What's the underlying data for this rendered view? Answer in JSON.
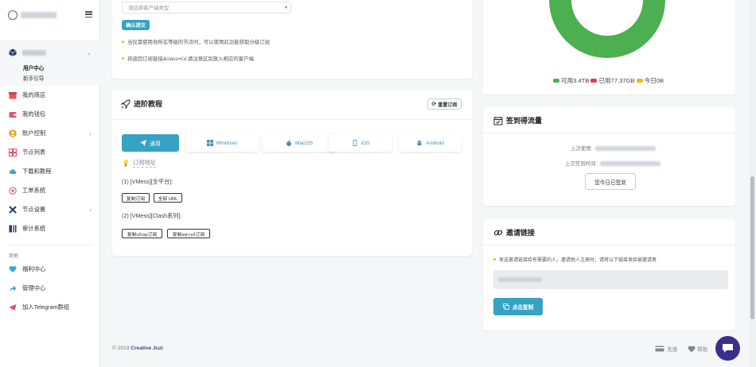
{
  "sidebar": {
    "nav": {
      "user_submenu": [
        "用户中心",
        "新手引导"
      ],
      "items": [
        {
          "label": "我的商店",
          "icon": "store-icon",
          "color": "#e85555"
        },
        {
          "label": "我的钱包",
          "icon": "wallet-icon",
          "color": "#e05470"
        },
        {
          "label": "账户控制",
          "icon": "account-icon",
          "color": "#f0a020",
          "chevron": "›"
        },
        {
          "label": "节点列表",
          "icon": "node-list-icon",
          "color": "#e05470"
        },
        {
          "label": "下载和教程",
          "icon": "cloud-download-icon",
          "color": "#3aa7d6"
        },
        {
          "label": "工单系统",
          "icon": "ticket-icon",
          "color": "#e56a6a"
        },
        {
          "label": "节点设置",
          "icon": "tools-icon",
          "color": "#2b3a67",
          "chevron": "›"
        },
        {
          "label": "审计系统",
          "icon": "audit-icon",
          "color": "#2b3a67"
        }
      ],
      "other_heading": "其他",
      "other_items": [
        {
          "label": "福利中心",
          "icon": "heart-icon",
          "color": "#3aa7d6"
        },
        {
          "label": "管理中心",
          "icon": "share-icon",
          "color": "#3aa7d6"
        },
        {
          "label": "加入Telegram群组",
          "icon": "telegram-icon",
          "color": "#e04e6e"
        }
      ]
    }
  },
  "subscribe_card": {
    "select_placeholder": "请选择客户端类型",
    "confirm_button": "确认提交",
    "notes": [
      "当仅需使用你所在等级的节点时，可以使用此功能获取分级订阅",
      "将返回订阅链接&class=LV,请注意区别放入相应的客户端"
    ]
  },
  "tutorial_card": {
    "title": "进阶教程",
    "reset_button": "重置订阅",
    "tabs": [
      {
        "label": "通用",
        "icon": "send-icon",
        "active": true
      },
      {
        "label": "Windows",
        "icon": "windows-icon",
        "active": false
      },
      {
        "label": "MacOS",
        "icon": "apple-icon",
        "active": false
      },
      {
        "label": "iOS",
        "icon": "phone-icon",
        "active": false
      },
      {
        "label": "Android",
        "icon": "android-icon",
        "active": false
      }
    ],
    "sub_address_label": "订阅地址",
    "vmess_all_label": "(1) [VMess][全平台]:",
    "vmess_all_buttons": [
      "复制订阅",
      "全部 URL"
    ],
    "vmess_clash_label": "(2) [VMess][Clash系列]:",
    "vmess_clash_buttons": [
      "复制v2ray订阅",
      "复制ssr+v2订阅"
    ]
  },
  "traffic_chart": {
    "colors": {
      "available": "#4caf50",
      "used": "#e53950",
      "today": "#f2b90c"
    },
    "legend": [
      {
        "label": "可用3.4TB",
        "key": "available"
      },
      {
        "label": "已用77.37GB",
        "key": "used"
      },
      {
        "label": "今日0B",
        "key": "today"
      }
    ]
  },
  "checkin_card": {
    "title": "签到得流量",
    "last_used_label": "上次使用:",
    "last_checkin_label": "上次签到时间:",
    "button": "您今日已签到"
  },
  "invite_card": {
    "title": "邀请链接",
    "note": "发送邀请链接给有需要的人，邀请他人注册时，请将以下链接发给被邀请者",
    "copy_button": "点击复制"
  },
  "footer": {
    "copyright": "© 2019",
    "brand": "Creative Juzi",
    "links": [
      "充值",
      "帮助"
    ]
  }
}
